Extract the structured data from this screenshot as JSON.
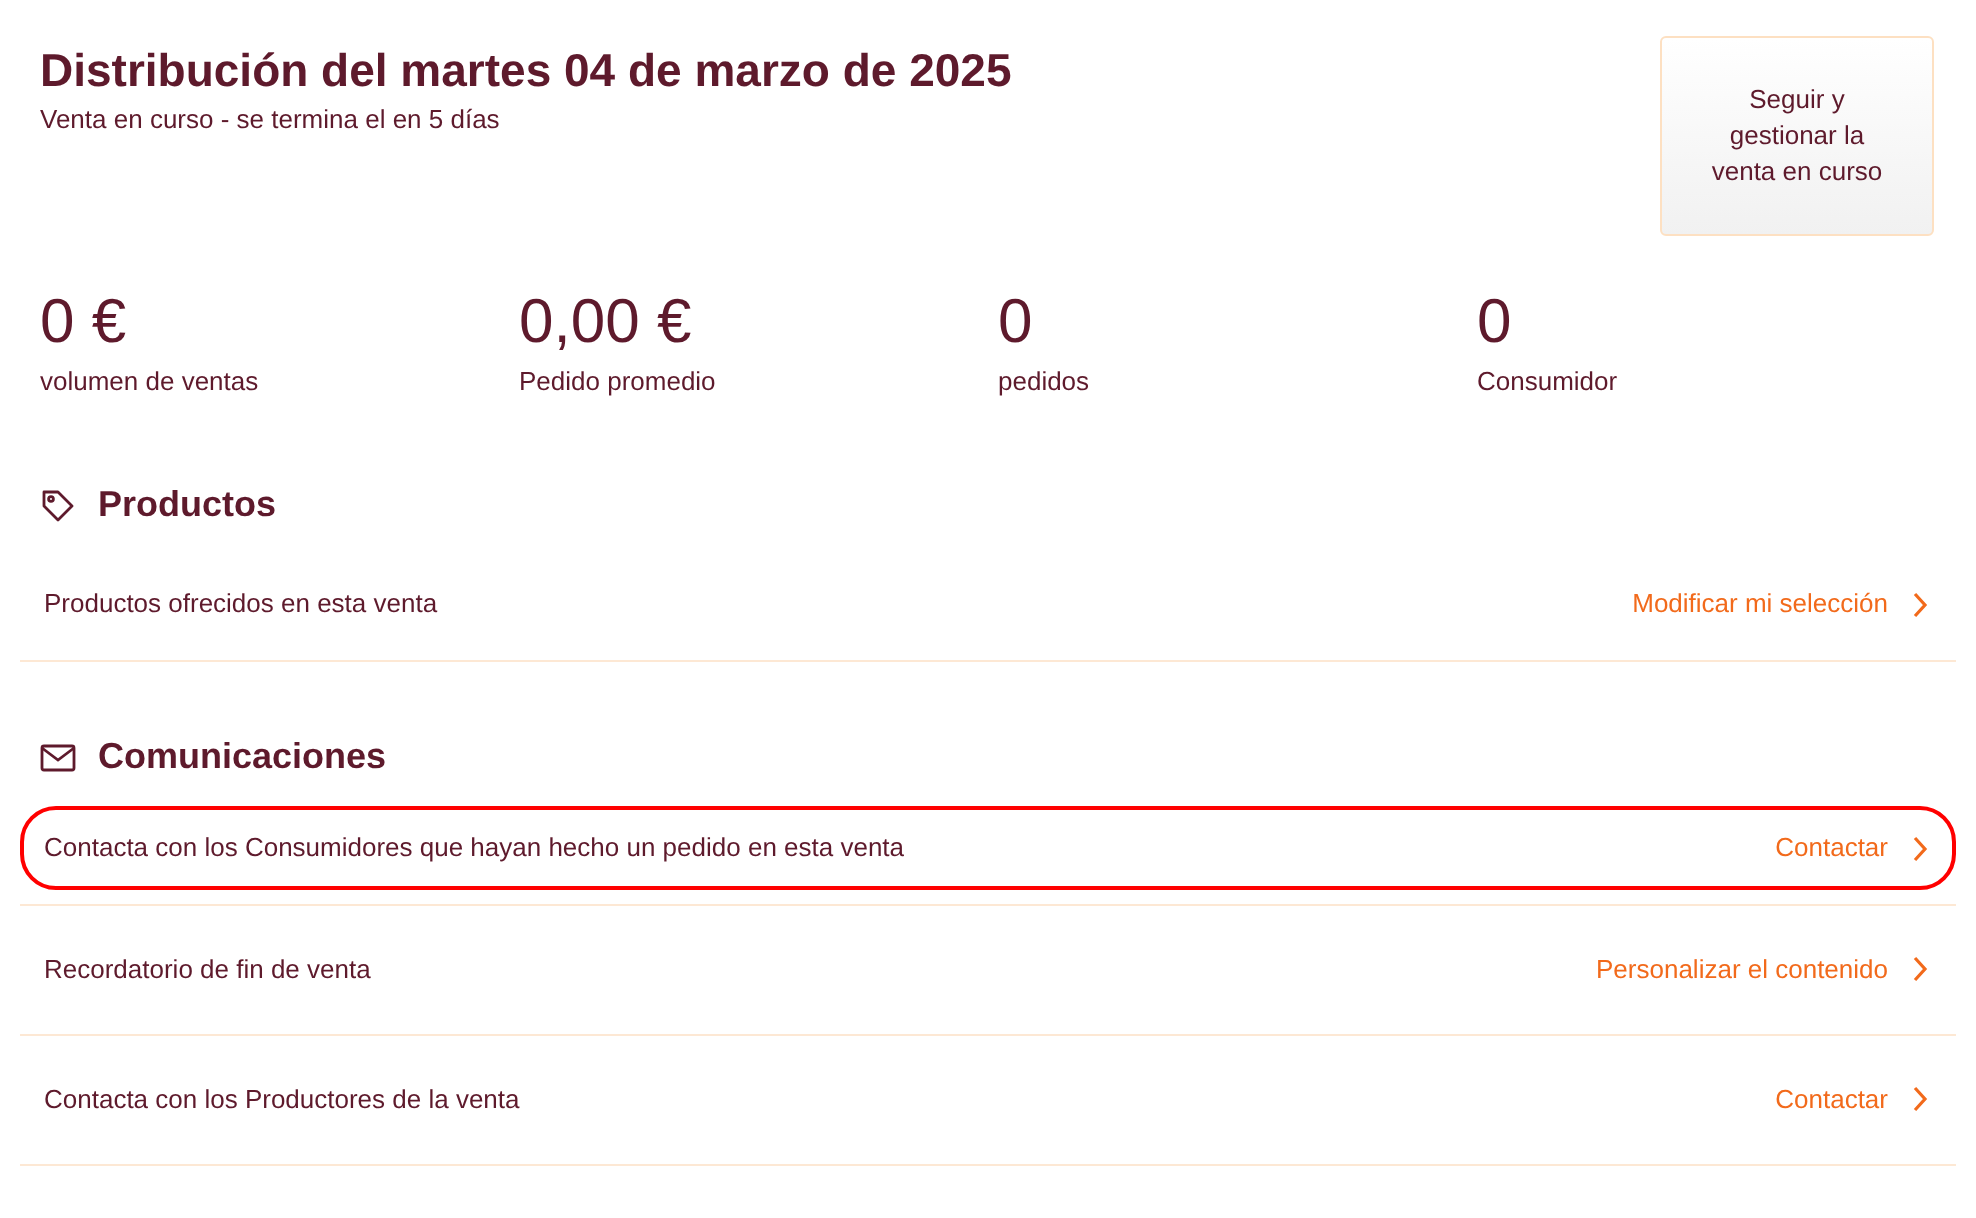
{
  "header": {
    "title": "Distribución del martes 04 de marzo de 2025",
    "subtitle": "Venta en curso - se termina el en 5 días",
    "button": "Seguir y gestionar la venta en curso"
  },
  "stats": [
    {
      "value": "0 €",
      "label": "volumen de ventas"
    },
    {
      "value": "0,00 €",
      "label": "Pedido promedio"
    },
    {
      "value": "0",
      "label": "pedidos"
    },
    {
      "value": "0",
      "label": "Consumidor"
    }
  ],
  "sections": [
    {
      "kind": "tag",
      "title": "Productos",
      "rows": [
        {
          "text": "Productos ofrecidos en esta venta",
          "action": "Modificar mi selección",
          "highlighted": false
        }
      ]
    },
    {
      "kind": "mail",
      "title": "Comunicaciones",
      "rows": [
        {
          "text": "Contacta con los Consumidores que hayan hecho un pedido en esta venta",
          "action": "Contactar",
          "highlighted": true
        },
        {
          "text": "Recordatorio de fin de venta",
          "action": "Personalizar el contenido",
          "highlighted": false
        },
        {
          "text": "Contacta con los Productores de la venta",
          "action": "Contactar",
          "highlighted": false
        }
      ]
    }
  ]
}
